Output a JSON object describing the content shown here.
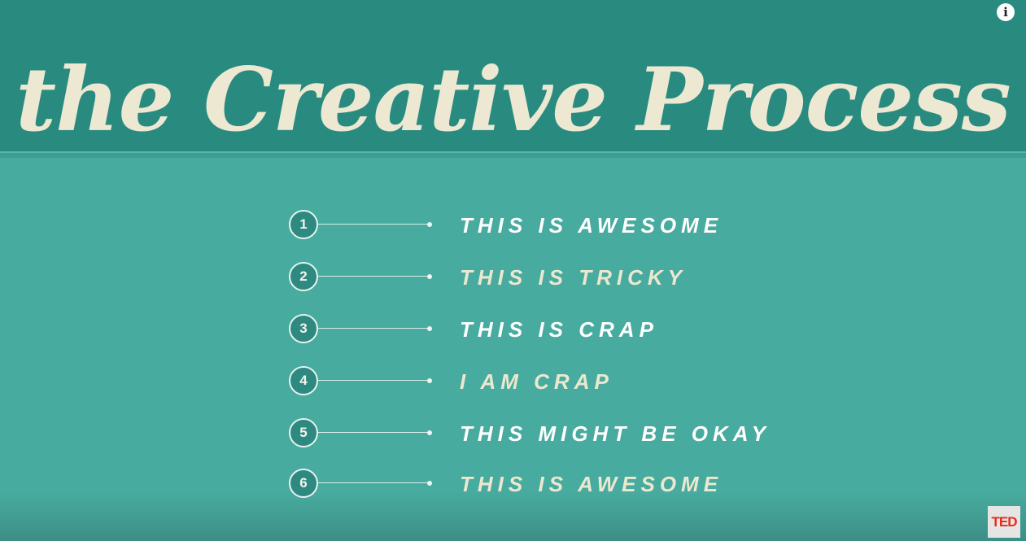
{
  "slide": {
    "title": "the Creative Process",
    "steps": [
      {
        "number": "1",
        "label": "THIS IS AWESOME"
      },
      {
        "number": "2",
        "label": "THIS IS TRICKY"
      },
      {
        "number": "3",
        "label": "THIS IS CRAP"
      },
      {
        "number": "4",
        "label": "I AM CRAP"
      },
      {
        "number": "5",
        "label": "THIS MIGHT BE OKAY"
      },
      {
        "number": "6",
        "label": "THIS IS AWESOME"
      }
    ]
  },
  "overlay": {
    "info_icon": "info-icon",
    "info_glyph": "i",
    "logo_text": "TED"
  },
  "colors": {
    "header_bg": "#298b80",
    "body_bg": "#48ab9f",
    "title_text": "#ece8d2",
    "bright_label": "#ffffff",
    "cream_label": "#ece8cf",
    "logo_red": "#e62b1e"
  }
}
